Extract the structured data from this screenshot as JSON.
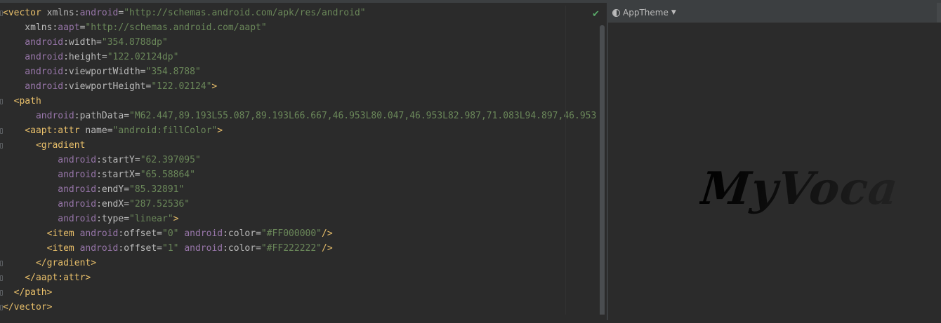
{
  "editor": {
    "status_check": "✔",
    "lines": [
      [
        {
          "c": "t",
          "v": "<vector "
        },
        {
          "c": "an",
          "v": "xmlns:"
        },
        {
          "c": "ns",
          "v": "android"
        },
        {
          "c": "an",
          "v": "="
        },
        {
          "c": "av",
          "v": "\"http://schemas.android.com/apk/res/android\""
        }
      ],
      [
        {
          "c": "an",
          "v": "    xmlns:"
        },
        {
          "c": "ns",
          "v": "aapt"
        },
        {
          "c": "an",
          "v": "="
        },
        {
          "c": "av",
          "v": "\"http://schemas.android.com/aapt\""
        }
      ],
      [
        {
          "c": "ns",
          "v": "    android"
        },
        {
          "c": "an",
          "v": ":width="
        },
        {
          "c": "av",
          "v": "\"354.8788dp\""
        }
      ],
      [
        {
          "c": "ns",
          "v": "    android"
        },
        {
          "c": "an",
          "v": ":height="
        },
        {
          "c": "av",
          "v": "\"122.02124dp\""
        }
      ],
      [
        {
          "c": "ns",
          "v": "    android"
        },
        {
          "c": "an",
          "v": ":viewportWidth="
        },
        {
          "c": "av",
          "v": "\"354.8788\""
        }
      ],
      [
        {
          "c": "ns",
          "v": "    android"
        },
        {
          "c": "an",
          "v": ":viewportHeight="
        },
        {
          "c": "av",
          "v": "\"122.02124\""
        },
        {
          "c": "t",
          "v": ">"
        }
      ],
      [
        {
          "c": "t",
          "v": "  <path"
        }
      ],
      [
        {
          "c": "ns",
          "v": "      android"
        },
        {
          "c": "an",
          "v": ":pathData="
        },
        {
          "c": "av",
          "v": "\"M62.447,89.193L55.087,89.193L66.667,46.953L80.047,46.953L82.987,71.083L94.897,46.953"
        }
      ],
      [
        {
          "c": "t",
          "v": "    <aapt:attr "
        },
        {
          "c": "an",
          "v": "name="
        },
        {
          "c": "av",
          "v": "\"android:fillColor\""
        },
        {
          "c": "t",
          "v": ">"
        }
      ],
      [
        {
          "c": "t",
          "v": "      <gradient"
        }
      ],
      [
        {
          "c": "ns",
          "v": "          android"
        },
        {
          "c": "an",
          "v": ":startY="
        },
        {
          "c": "av",
          "v": "\"62.397095\""
        }
      ],
      [
        {
          "c": "ns",
          "v": "          android"
        },
        {
          "c": "an",
          "v": ":startX="
        },
        {
          "c": "av",
          "v": "\"65.58864\""
        }
      ],
      [
        {
          "c": "ns",
          "v": "          android"
        },
        {
          "c": "an",
          "v": ":endY="
        },
        {
          "c": "av",
          "v": "\"85.32891\""
        }
      ],
      [
        {
          "c": "ns",
          "v": "          android"
        },
        {
          "c": "an",
          "v": ":endX="
        },
        {
          "c": "av",
          "v": "\"287.52536\""
        }
      ],
      [
        {
          "c": "ns",
          "v": "          android"
        },
        {
          "c": "an",
          "v": ":type="
        },
        {
          "c": "av",
          "v": "\"linear\""
        },
        {
          "c": "t",
          "v": ">"
        }
      ],
      [
        {
          "c": "t",
          "v": "        <item "
        },
        {
          "c": "ns",
          "v": "android"
        },
        {
          "c": "an",
          "v": ":offset="
        },
        {
          "c": "av",
          "v": "\"0\" "
        },
        {
          "c": "ns",
          "v": "android"
        },
        {
          "c": "an",
          "v": ":color="
        },
        {
          "c": "av",
          "v": "\"#FF000000\""
        },
        {
          "c": "t",
          "v": "/>"
        }
      ],
      [
        {
          "c": "t",
          "v": "        <item "
        },
        {
          "c": "ns",
          "v": "android"
        },
        {
          "c": "an",
          "v": ":offset="
        },
        {
          "c": "av",
          "v": "\"1\" "
        },
        {
          "c": "ns",
          "v": "android"
        },
        {
          "c": "an",
          "v": ":color="
        },
        {
          "c": "av",
          "v": "\"#FF222222\""
        },
        {
          "c": "t",
          "v": "/>"
        }
      ],
      [
        {
          "c": "t",
          "v": "      </gradient>"
        }
      ],
      [
        {
          "c": "t",
          "v": "    </aapt:attr>"
        }
      ],
      [
        {
          "c": "t",
          "v": "  </path>"
        }
      ],
      [
        {
          "c": "t",
          "v": "</vector>"
        }
      ]
    ]
  },
  "preview": {
    "theme_label": "AppTheme",
    "theme_icon": "theme-icon",
    "dropdown_icon": "chevron-down-icon",
    "logo_text": "MyVoca",
    "gradient_start": "#000000",
    "gradient_end": "#222222"
  },
  "colors": {
    "background": "#2b2b2b",
    "tag": "#e8bf6a",
    "namespace": "#9876aa",
    "attribute": "#bababa",
    "value": "#6a8759"
  }
}
